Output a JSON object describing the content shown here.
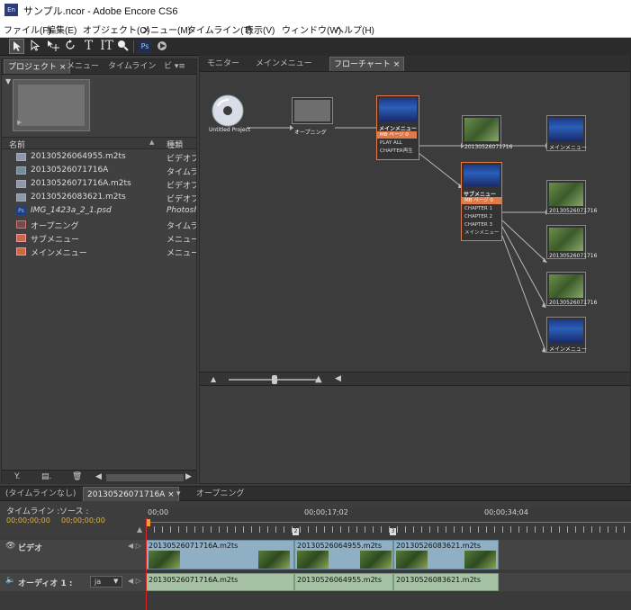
{
  "window": {
    "title": "サンプル.ncor - Adobe Encore CS6",
    "app_icon": "En"
  },
  "menubar": [
    "ファイル(F)",
    "編集(E)",
    "オブジェクト(O)",
    "メニュー(M)",
    "タイムライン(T)",
    "表示(V)",
    "ウィンドウ(W)",
    "ヘルプ(H)"
  ],
  "toolbar": {
    "tools": [
      "selection-tool-icon",
      "direct-select-tool-icon",
      "move-tool-icon",
      "rotate-tool-icon",
      "text-tool-icon",
      "vertical-text-tool-icon",
      "zoom-tool-icon",
      "photoshop-edit-icon",
      "preview-icon"
    ],
    "ps_label": "Ps"
  },
  "project_panel": {
    "tabs": [
      "プロジェクト ×",
      "メニュー",
      "タイムライン",
      "ビ ▾≡"
    ],
    "col_name": "名前",
    "col_type": "種類",
    "sort_glyph": "▲",
    "items": [
      {
        "name": "20130526064955.m2ts",
        "type": "ビデオファ",
        "icon": "video"
      },
      {
        "name": "20130526071716A",
        "type": "タイムライ",
        "icon": "timeline"
      },
      {
        "name": "20130526071716A.m2ts",
        "type": "ビデオファ",
        "icon": "video"
      },
      {
        "name": "20130526083621.m2ts",
        "type": "ビデオファ",
        "icon": "video"
      },
      {
        "name": "IMG_1423a_2_1.psd",
        "type": "Photosh",
        "icon": "ps"
      },
      {
        "name": "オープニング",
        "type": "タイムライ",
        "icon": "timeline"
      },
      {
        "name": "サブメニュー",
        "type": "メニュー",
        "icon": "menu"
      },
      {
        "name": "メインメニュー",
        "type": "メニュー",
        "icon": "menu"
      }
    ]
  },
  "flowchart": {
    "tabs": [
      "モニター",
      "メインメニュー",
      "フローチャート ×"
    ],
    "nodes": {
      "project": "Untitled Project",
      "opening": "オープニング",
      "main_menu": "メインメニュー",
      "main_page": "ページ 0",
      "main_buttons": [
        "PLAY ALL",
        "CHAPTER再生"
      ],
      "main_badge": "MB",
      "sub_menu": "サブメニュー",
      "sub_page": "ページ 0",
      "sub_buttons": [
        "CHAPTER 1",
        "CHAPTER 2",
        "CHAPTER 3",
        "メインメニュー"
      ],
      "timeline_a": "20130526071716",
      "right_nodes": [
        "メインメニュー",
        "20130526071716",
        "20130526071716",
        "20130526071716",
        "メインメニュー"
      ]
    }
  },
  "timeline": {
    "tabs": [
      "(タイムラインなし)",
      "20130526071716A ×",
      "▾",
      "オープニング"
    ],
    "label_timeline": "タイムライン :",
    "label_source": "ソース :",
    "tc_timeline": "00;00;00;00",
    "tc_source": "00;00;00;00",
    "ruler": [
      "00;00",
      "00;00;17;02",
      "00;00;34;04"
    ],
    "chapters": [
      "1",
      "2",
      "3"
    ],
    "video_track": "ビデオ",
    "audio_track": "オーディオ 1 :",
    "audio_lang": "ja",
    "clips": [
      "20130526071716A.m2ts",
      "20130526064955.m2ts",
      "20130526083621.m2ts"
    ]
  }
}
